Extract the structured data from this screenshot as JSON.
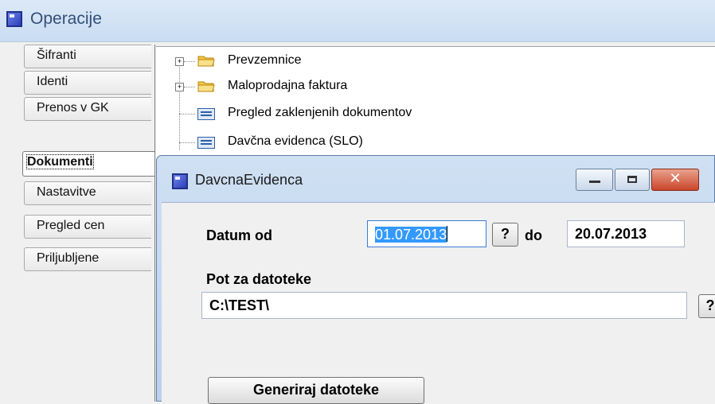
{
  "app": {
    "title": "Operacije"
  },
  "tabs": [
    {
      "label": "Šifranti",
      "active": false
    },
    {
      "label": "Identi",
      "active": false
    },
    {
      "label": "Prenos v GK",
      "active": false
    },
    {
      "label": "Dokumenti",
      "active": true
    },
    {
      "label": "Nastavitve",
      "active": false
    },
    {
      "label": "Pregled cen",
      "active": false
    },
    {
      "label": "Priljubljene",
      "active": false
    }
  ],
  "tree": {
    "items": [
      {
        "label": "Prevzemnice",
        "icon": "folder-icon",
        "expandable": true
      },
      {
        "label": "Maloprodajna faktura",
        "icon": "folder-icon",
        "expandable": true
      },
      {
        "label": "Pregled zaklenjenih dokumentov",
        "icon": "document-icon",
        "expandable": false
      },
      {
        "label": "Davčna evidenca (SLO)",
        "icon": "document-icon",
        "expandable": false
      }
    ]
  },
  "dialog": {
    "title": "DavcnaEvidenca",
    "close_glyph": "✕",
    "datum_od_label": "Datum od",
    "datum_od_value": "01.07.2013",
    "lookup_label": "?",
    "do_label": "do",
    "datum_do_value": "20.07.2013",
    "pot_label": "Pot za datoteke",
    "pot_value": "C:\\TEST\\",
    "generate_label": "Generiraj datoteke"
  },
  "colors": {
    "title_bar": "#c9dcf2",
    "selection": "#3399ff",
    "close_button": "#c9462c"
  }
}
